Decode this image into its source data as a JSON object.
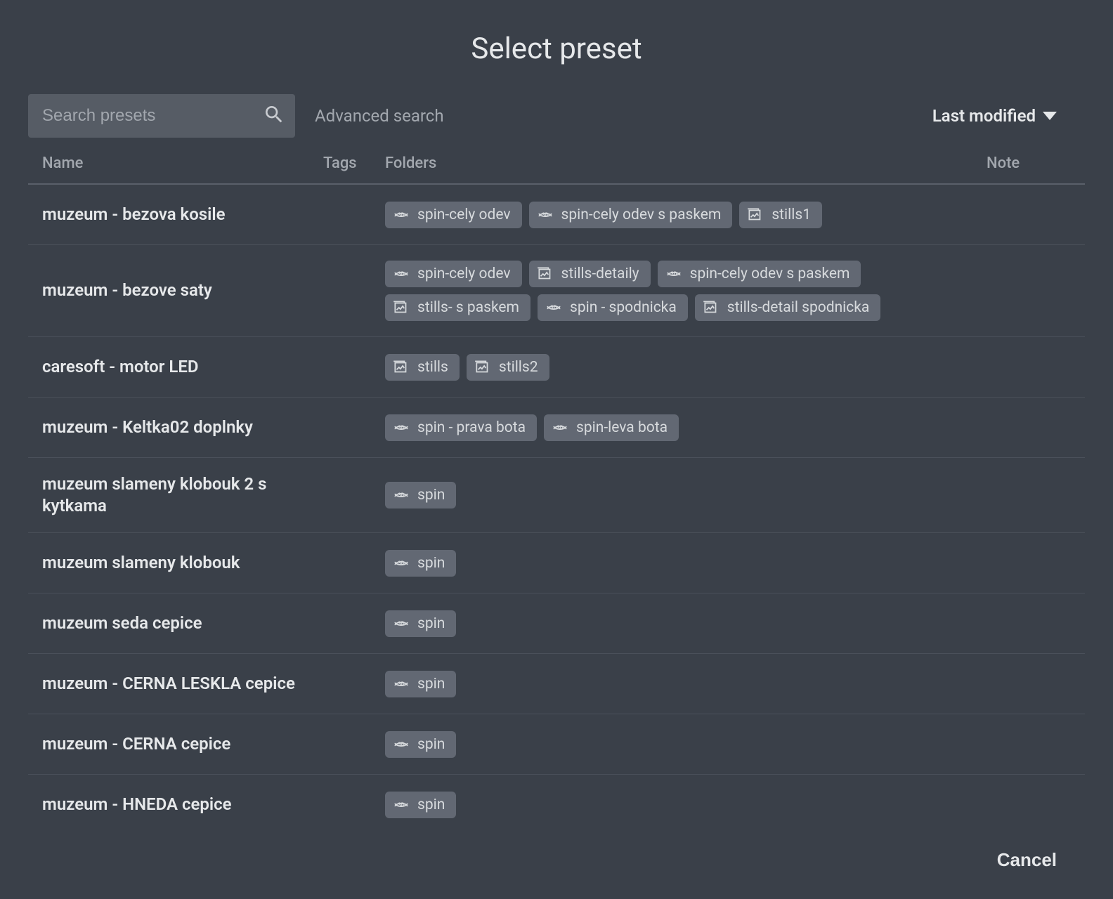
{
  "dialog": {
    "title": "Select preset",
    "search_placeholder": "Search presets",
    "advanced_search": "Advanced search",
    "sort_label": "Last modified",
    "cancel_label": "Cancel"
  },
  "columns": {
    "name": "Name",
    "tags": "Tags",
    "folders": "Folders",
    "note": "Note"
  },
  "rows": [
    {
      "name": "muzeum - bezova kosile",
      "folders": [
        {
          "icon": "spin",
          "label": "spin-cely odev"
        },
        {
          "icon": "spin",
          "label": "spin-cely odev s paskem"
        },
        {
          "icon": "stills",
          "label": "stills1"
        }
      ]
    },
    {
      "name": "muzeum - bezove saty",
      "folders": [
        {
          "icon": "spin",
          "label": "spin-cely odev"
        },
        {
          "icon": "stills",
          "label": "stills-detaily"
        },
        {
          "icon": "spin",
          "label": "spin-cely odev s paskem"
        },
        {
          "icon": "stills",
          "label": "stills- s paskem"
        },
        {
          "icon": "spin",
          "label": "spin - spodnicka"
        },
        {
          "icon": "stills",
          "label": "stills-detail spodnicka"
        }
      ]
    },
    {
      "name": "caresoft - motor LED",
      "folders": [
        {
          "icon": "stills",
          "label": "stills"
        },
        {
          "icon": "stills",
          "label": "stills2"
        }
      ]
    },
    {
      "name": "muzeum - Keltka02 doplnky",
      "folders": [
        {
          "icon": "spin",
          "label": "spin - prava bota"
        },
        {
          "icon": "spin",
          "label": "spin-leva bota"
        }
      ]
    },
    {
      "name": "muzeum slameny klobouk 2 s kytkama",
      "folders": [
        {
          "icon": "spin",
          "label": "spin"
        }
      ]
    },
    {
      "name": "muzeum slameny klobouk",
      "folders": [
        {
          "icon": "spin",
          "label": "spin"
        }
      ]
    },
    {
      "name": "muzeum seda cepice",
      "folders": [
        {
          "icon": "spin",
          "label": "spin"
        }
      ]
    },
    {
      "name": "muzeum - CERNA LESKLA cepice",
      "folders": [
        {
          "icon": "spin",
          "label": "spin"
        }
      ]
    },
    {
      "name": "muzeum - CERNA cepice",
      "folders": [
        {
          "icon": "spin",
          "label": "spin"
        }
      ]
    },
    {
      "name": "muzeum - HNEDA cepice",
      "folders": [
        {
          "icon": "spin",
          "label": "spin"
        }
      ]
    }
  ]
}
